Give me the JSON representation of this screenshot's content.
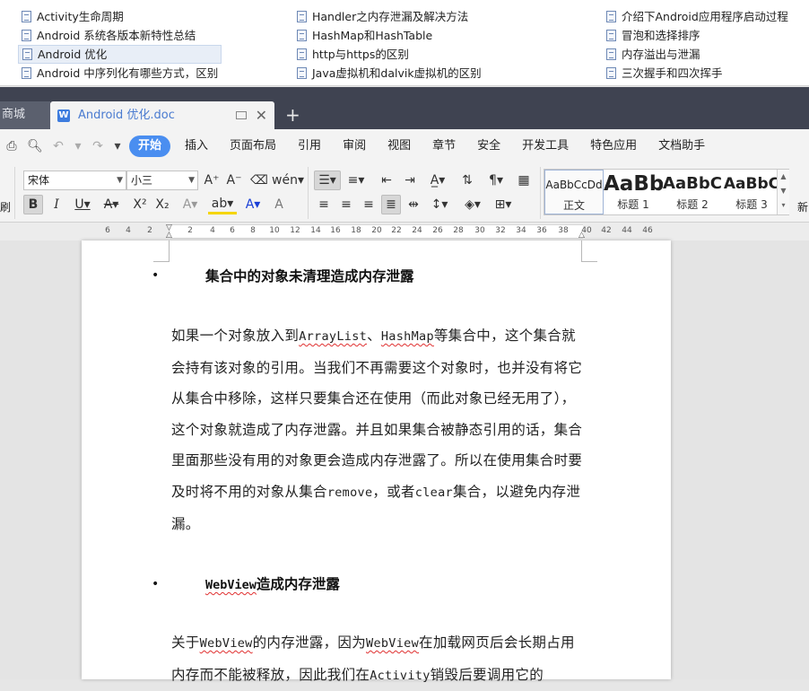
{
  "file_list": {
    "col1": [
      "Activity生命周期",
      "Android 系统各版本新特性总结",
      "Android 优化",
      "Android 中序列化有哪些方式，区别"
    ],
    "col2": [
      "Handler之内存泄漏及解决方法",
      "HashMap和HashTable",
      "http与https的区别",
      "Java虚拟机和dalvik虚拟机的区别"
    ],
    "col3": [
      "介绍下Android应用程序启动过程",
      "冒泡和选择排序",
      "内存溢出与泄漏",
      "三次握手和四次挥手"
    ]
  },
  "tabs": {
    "inactive_label": "商城",
    "active_label": "Android 优化.doc",
    "add_symbol": "+"
  },
  "menu": [
    "开始",
    "插入",
    "页面布局",
    "引用",
    "审阅",
    "视图",
    "章节",
    "安全",
    "开发工具",
    "特色应用",
    "文档助手"
  ],
  "ribbon": {
    "font_name": "宋体",
    "font_size": "小三",
    "left_edge_label": "刷",
    "right_edge_label": "新",
    "styles": [
      {
        "sample": "AaBbCcDd",
        "name": "正文"
      },
      {
        "sample": "AaBb",
        "name": "标题 1"
      },
      {
        "sample": "AaBbC",
        "name": "标题 2"
      },
      {
        "sample": "AaBbC",
        "name": "标题 3"
      }
    ]
  },
  "ruler_numbers": [
    "6",
    "4",
    "2",
    "2",
    "4",
    "6",
    "8",
    "10",
    "12",
    "14",
    "16",
    "18",
    "20",
    "22",
    "24",
    "26",
    "28",
    "30",
    "32",
    "34",
    "36",
    "38",
    "40",
    "42",
    "44",
    "46"
  ],
  "document": {
    "heading1": "集合中的对象未清理造成内存泄露",
    "para1": {
      "t1": "如果一个对象放入到",
      "c1": "ArrayList",
      "t2": "、",
      "c2": "HashMap",
      "t3": "等集合中，这个集合就会持有该对象的引用。当我们不再需要这个对象时，也并没有将它从集合中移除，这样只要集合还在使用（而此对象已经无用了），这个对象就造成了内存泄露。并且如果集合被静态引用的话，集合里面那些没有用的对象更会造成内存泄露了。所以在使用集合时要及时将不用的对象从集合",
      "c3": "remove",
      "t4": "，或者",
      "c4": "clear",
      "t5": "集合，以避免内存泄漏。"
    },
    "heading2_code": "WebView",
    "heading2_text": "造成内存泄露",
    "para2": {
      "t1": "关于",
      "c1": "WebView",
      "t2": "的内存泄露，因为",
      "c2": "WebView",
      "t3": "在加载网页后会长期占用内存而不能被释放，因此我们在",
      "c3": "Activity",
      "t4": "销毁后要调用它的"
    },
    "bullet_symbol": "•"
  }
}
